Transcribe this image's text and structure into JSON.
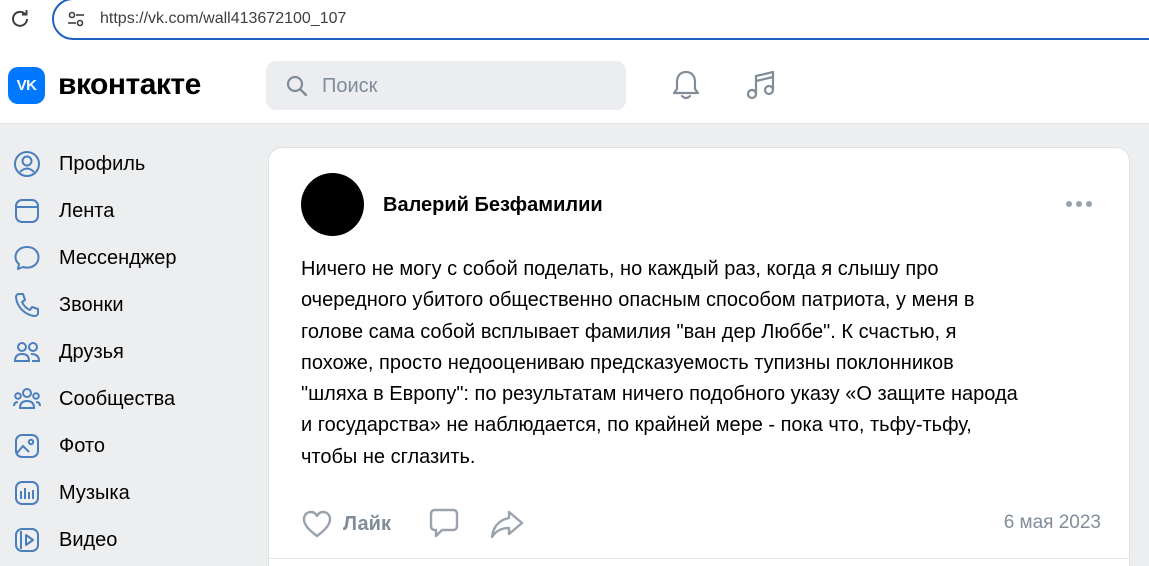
{
  "browser": {
    "url": "https://vk.com/wall413672100_107"
  },
  "header": {
    "logo_mark": "VK",
    "logo_text": "вконтакте",
    "search_placeholder": "Поиск",
    "icons": [
      "bell-icon",
      "music-icon"
    ]
  },
  "sidebar": {
    "items": [
      {
        "label": "Профиль",
        "icon": "profile-icon"
      },
      {
        "label": "Лента",
        "icon": "feed-icon"
      },
      {
        "label": "Мессенджер",
        "icon": "messenger-icon"
      },
      {
        "label": "Звонки",
        "icon": "phone-icon"
      },
      {
        "label": "Друзья",
        "icon": "friends-icon"
      },
      {
        "label": "Сообщества",
        "icon": "communities-icon"
      },
      {
        "label": "Фото",
        "icon": "photo-icon"
      },
      {
        "label": "Музыка",
        "icon": "music-icon"
      },
      {
        "label": "Видео",
        "icon": "video-icon"
      }
    ]
  },
  "post": {
    "author": "Валерий Безфамилии",
    "text_lines": [
      "Ничего не могу с собой поделать, но каждый раз, когда я слышу про",
      "очередного убитого общественно опасным способом патриота, у меня в",
      "голове сама собой всплывает фамилия \"ван дер Люббе\". К счастью, я",
      "похоже, просто недооцениваю предсказуемость тупизны поклонников",
      "\"шляха в Европу\": по результатам ничего подобного указу «О защите народа",
      "и государства» не наблюдается, по крайней мере - пока что, тьфу-тьфу,",
      "чтобы не сглазить."
    ],
    "like_label": "Лайк",
    "date": "6 мая 2023"
  },
  "colors": {
    "accent": "#0077ff",
    "address_border": "#1f5fbf",
    "icon_blue": "#4a7fbd",
    "secondary_text": "#818c99",
    "page_bg": "#edeef0"
  }
}
